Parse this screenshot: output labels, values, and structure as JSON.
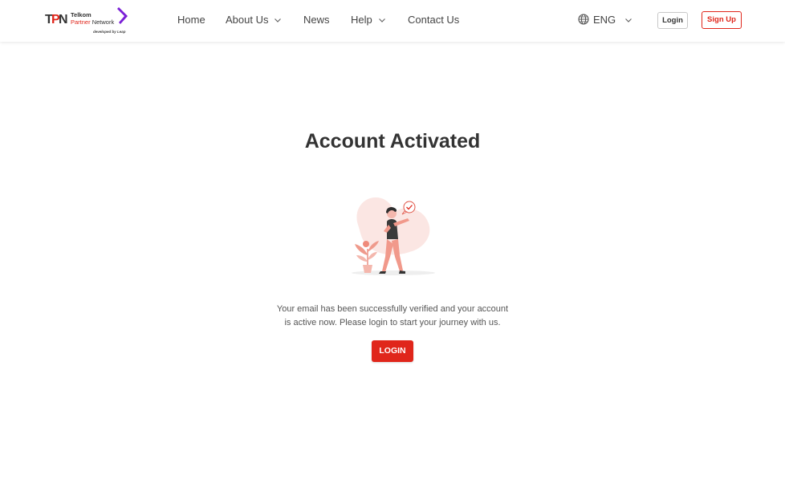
{
  "brand": {
    "logo_mark": "TPN",
    "line1": "Telkom",
    "line2_a": "Partner",
    "line2_b": " Network",
    "tagline": "developed by Leap",
    "accent_color": "#e0261b",
    "chevron_color": "#7a1fd6"
  },
  "nav": {
    "home": "Home",
    "about": "About Us",
    "news": "News",
    "help": "Help",
    "contact": "Contact Us"
  },
  "language": {
    "icon": "globe-icon",
    "value": "ENG"
  },
  "auth": {
    "login_label": "Login",
    "signup_label": "Sign Up"
  },
  "main": {
    "title": "Account Activated",
    "message_line1": "Your email has been successfully verified and your account",
    "message_line2": "is active now. Please login to start your journey with us.",
    "cta_label": "LOGIN"
  }
}
